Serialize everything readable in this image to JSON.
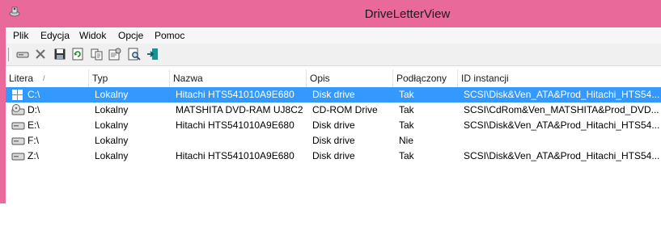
{
  "window": {
    "title": "DriveLetterView"
  },
  "menu": [
    "Plik",
    "Edycja",
    "Widok",
    "Opcje",
    "Pomoc"
  ],
  "toolbar": {
    "icons": [
      "drive-icon",
      "delete-x-icon",
      "save-icon",
      "refresh-icon",
      "copy-icon",
      "properties-icon",
      "find-icon",
      "exit-icon"
    ]
  },
  "table": {
    "columns": [
      "Litera",
      "Typ",
      "Nazwa",
      "Opis",
      "Podłączony",
      "ID instancji"
    ],
    "sort_indicator": "/",
    "rows": [
      {
        "letter": "C:\\",
        "type": "Lokalny",
        "name": "Hitachi HTS541010A9E680",
        "desc": "Disk drive",
        "connected": "Tak",
        "id": "SCSI\\Disk&Ven_ATA&Prod_Hitachi_HTS54...",
        "icon": "windows-drive-icon",
        "selected": true
      },
      {
        "letter": "D:\\",
        "type": "Lokalny",
        "name": "MATSHITA DVD-RAM UJ8C2",
        "desc": "CD-ROM Drive",
        "connected": "Tak",
        "id": "SCSI\\CdRom&Ven_MATSHITA&Prod_DVD...",
        "icon": "cdrom-drive-icon",
        "selected": false
      },
      {
        "letter": "E:\\",
        "type": "Lokalny",
        "name": "Hitachi HTS541010A9E680",
        "desc": "Disk drive",
        "connected": "Tak",
        "id": "SCSI\\Disk&Ven_ATA&Prod_Hitachi_HTS54...",
        "icon": "hard-drive-icon",
        "selected": false
      },
      {
        "letter": "F:\\",
        "type": "Lokalny",
        "name": "",
        "desc": "Disk drive",
        "connected": "Nie",
        "id": "",
        "icon": "hard-drive-icon",
        "selected": false
      },
      {
        "letter": "Z:\\",
        "type": "Lokalny",
        "name": "Hitachi HTS541010A9E680",
        "desc": "Disk drive",
        "connected": "Tak",
        "id": "SCSI\\Disk&Ven_ATA&Prod_Hitachi_HTS54...",
        "icon": "hard-drive-icon",
        "selected": false
      }
    ]
  },
  "colors": {
    "frame": "#e8699a",
    "selection": "#3399ff"
  }
}
